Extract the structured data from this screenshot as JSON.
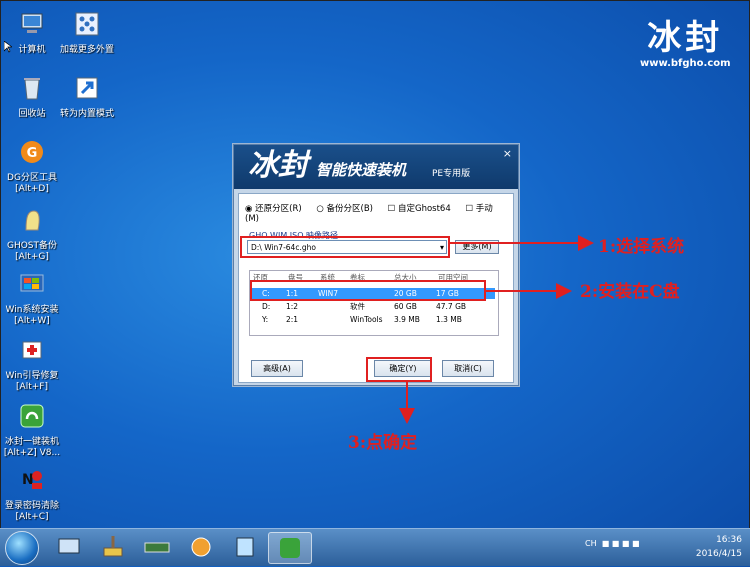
{
  "desktop": {
    "icons": [
      {
        "label": "计算机"
      },
      {
        "label": "加载更多外置"
      },
      {
        "label": "回收站"
      },
      {
        "label": "转为内置模式"
      },
      {
        "label": "DG分区工具\n[Alt+D]"
      },
      {
        "label": "GHOST备份\n[Alt+G]"
      },
      {
        "label": "Win系统安装\n[Alt+W]"
      },
      {
        "label": "Win引导修复\n[Alt+F]"
      },
      {
        "label": "冰封一键装机\n[Alt+Z] V8..."
      },
      {
        "label": "登录密码清除\n[Alt+C]"
      }
    ]
  },
  "logo": {
    "title": "冰封",
    "url": "www.bfgho.com"
  },
  "dialog": {
    "title": "冰封",
    "subtitle": "智能快速装机",
    "pe": "PE专用版",
    "close": "×",
    "options": {
      "restore": "还原分区(R)",
      "backup": "备份分区(B)",
      "custom": "自定Ghost64",
      "manual": "手动(M)"
    },
    "path_label": "GHO WIM ISO 映像路径",
    "path_value": "D:\\ Win7-64c.gho",
    "more_button": "更多(M)",
    "table": {
      "headers": [
        "还原",
        "盘号",
        "系统",
        "卷标",
        "总大小",
        "可用空间"
      ],
      "rows": [
        {
          "drive": "C:",
          "num": "1:1",
          "sys": "WIN7",
          "label": "",
          "total": "20 GB",
          "free": "17 GB",
          "selected": true
        },
        {
          "drive": "D:",
          "num": "1:2",
          "sys": "",
          "label": "软件",
          "total": "60 GB",
          "free": "47.7 GB",
          "selected": false
        },
        {
          "drive": "Y:",
          "num": "2:1",
          "sys": "",
          "label": "WinTools",
          "total": "3.9 MB",
          "free": "1.3 MB",
          "selected": false
        }
      ]
    },
    "advanced_button": "高级(A)",
    "ok_button": "确定(Y)",
    "cancel_button": "取消(C)"
  },
  "annotations": {
    "step1": "1:选择系统",
    "step2": "2:安装在C盘",
    "step3": "3:点确定"
  },
  "taskbar": {
    "lang": "CH",
    "time": "16:36",
    "date": "2016/4/15"
  },
  "colors": {
    "desktop_bg": "#1466c8",
    "annotation_red": "#e02020",
    "selection": "#3399ff"
  }
}
